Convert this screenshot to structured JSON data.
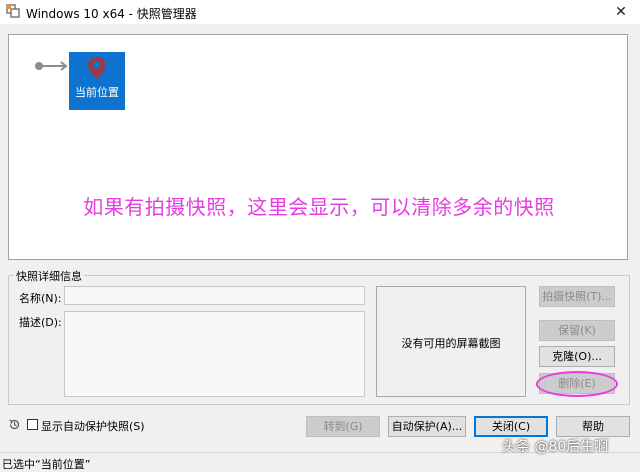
{
  "window": {
    "title": "Windows 10 x64 - 快照管理器",
    "close_glyph": "✕"
  },
  "tree": {
    "current_node_label": "当前位置",
    "annotation": "如果有拍摄快照，这里会显示，可以清除多余的快照"
  },
  "details": {
    "group_title": "快照详细信息",
    "name_label": "名称(N):",
    "name_value": "",
    "description_label": "描述(D):",
    "description_value": "",
    "screenshot_placeholder": "没有可用的屏幕截图"
  },
  "buttons": {
    "take_snapshot": "拍摄快照(T)...",
    "keep": "保留(K)",
    "clone": "克隆(O)...",
    "delete": "删除(E)",
    "goto": "转到(G)",
    "autoprotect": "自动保护(A)...",
    "close": "关闭(C)",
    "help": "帮助"
  },
  "options": {
    "show_autoprotect_label": "显示自动保护快照(S)",
    "show_autoprotect_checked": false
  },
  "status": {
    "text": "已选中“当前位置”"
  },
  "watermark": {
    "text": "头条 @80后生啊"
  },
  "colors": {
    "node_fill": "#0e73cf",
    "annotation": "#e83ce3",
    "highlight_ellipse": "#e83ce3"
  },
  "icons": {
    "app": "vmware-icon",
    "node": "location-pin-icon",
    "restore": "restore-clock-icon"
  }
}
